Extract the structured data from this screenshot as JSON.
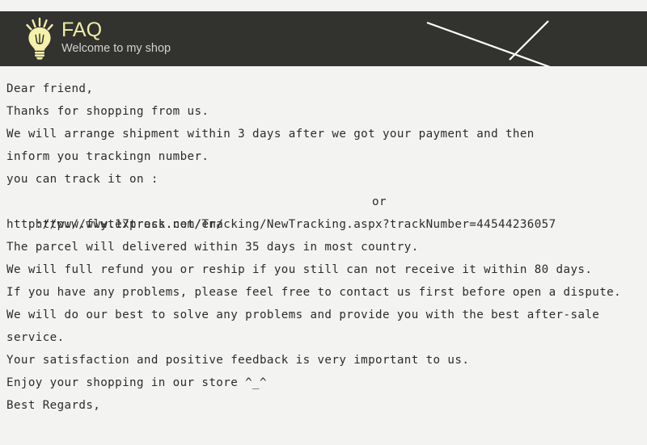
{
  "page": {
    "background_color": "#f3f3f2",
    "text_color": "#2b2b2b"
  },
  "header": {
    "background_color": "#32322e",
    "title": "FAQ",
    "title_color": "#efeda6",
    "subtitle": "Welcome to my shop",
    "subtitle_color": "#d2d2d0",
    "icon": "lightbulb-icon",
    "decoration": "white-diagonal-chevron-lines",
    "decoration_color": "#ffffff"
  },
  "content": {
    "lines": [
      "Dear friend,",
      "Thanks for shopping from us.",
      "We will arrange shipment within 3 days after we got your payment and then",
      "inform you trackingn number.",
      "you can track it on :",
      "http://www.17track.net/en/",
      "http://www.flytexpress.com/Tracking/NewTracking.aspx?trackNumber=44544236057",
      "The parcel will delivered within 35 days in most country.",
      "We will full refund you or reship if you still can not receive it within 80 days.",
      "If you have any problems, please feel free to contact us first before open a dispute.",
      "We will do our best to solve any problems and provide you with the best after-sale",
      "service.",
      "Your satisfaction and positive feedback is very important to us.",
      "Enjoy your shopping in our store ^_^",
      "Best Regards,"
    ],
    "or_separator": "or",
    "tracking_number": "44544236057"
  }
}
